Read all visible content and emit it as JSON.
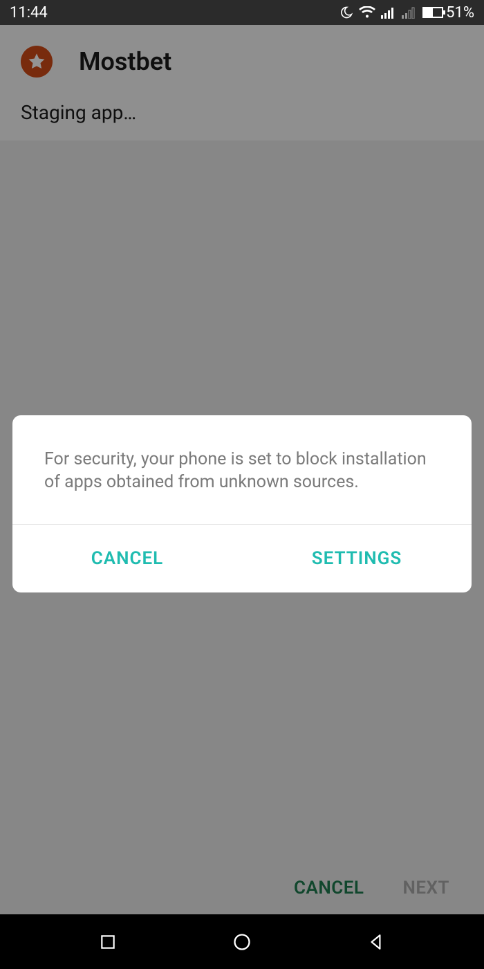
{
  "status_bar": {
    "time": "11:44",
    "battery_pct": "51%"
  },
  "app": {
    "name": "Mostbet",
    "subtitle": "Staging app…"
  },
  "background_actions": {
    "cancel": "CANCEL",
    "next": "NEXT"
  },
  "dialog": {
    "message": "For security, your phone is set to block installation of apps obtained from unknown sources.",
    "cancel": "CANCEL",
    "settings": "SETTINGS"
  },
  "colors": {
    "accent_teal": "#1fbcb0",
    "accent_green": "#1e7a4f",
    "app_icon": "#cf4a17"
  }
}
